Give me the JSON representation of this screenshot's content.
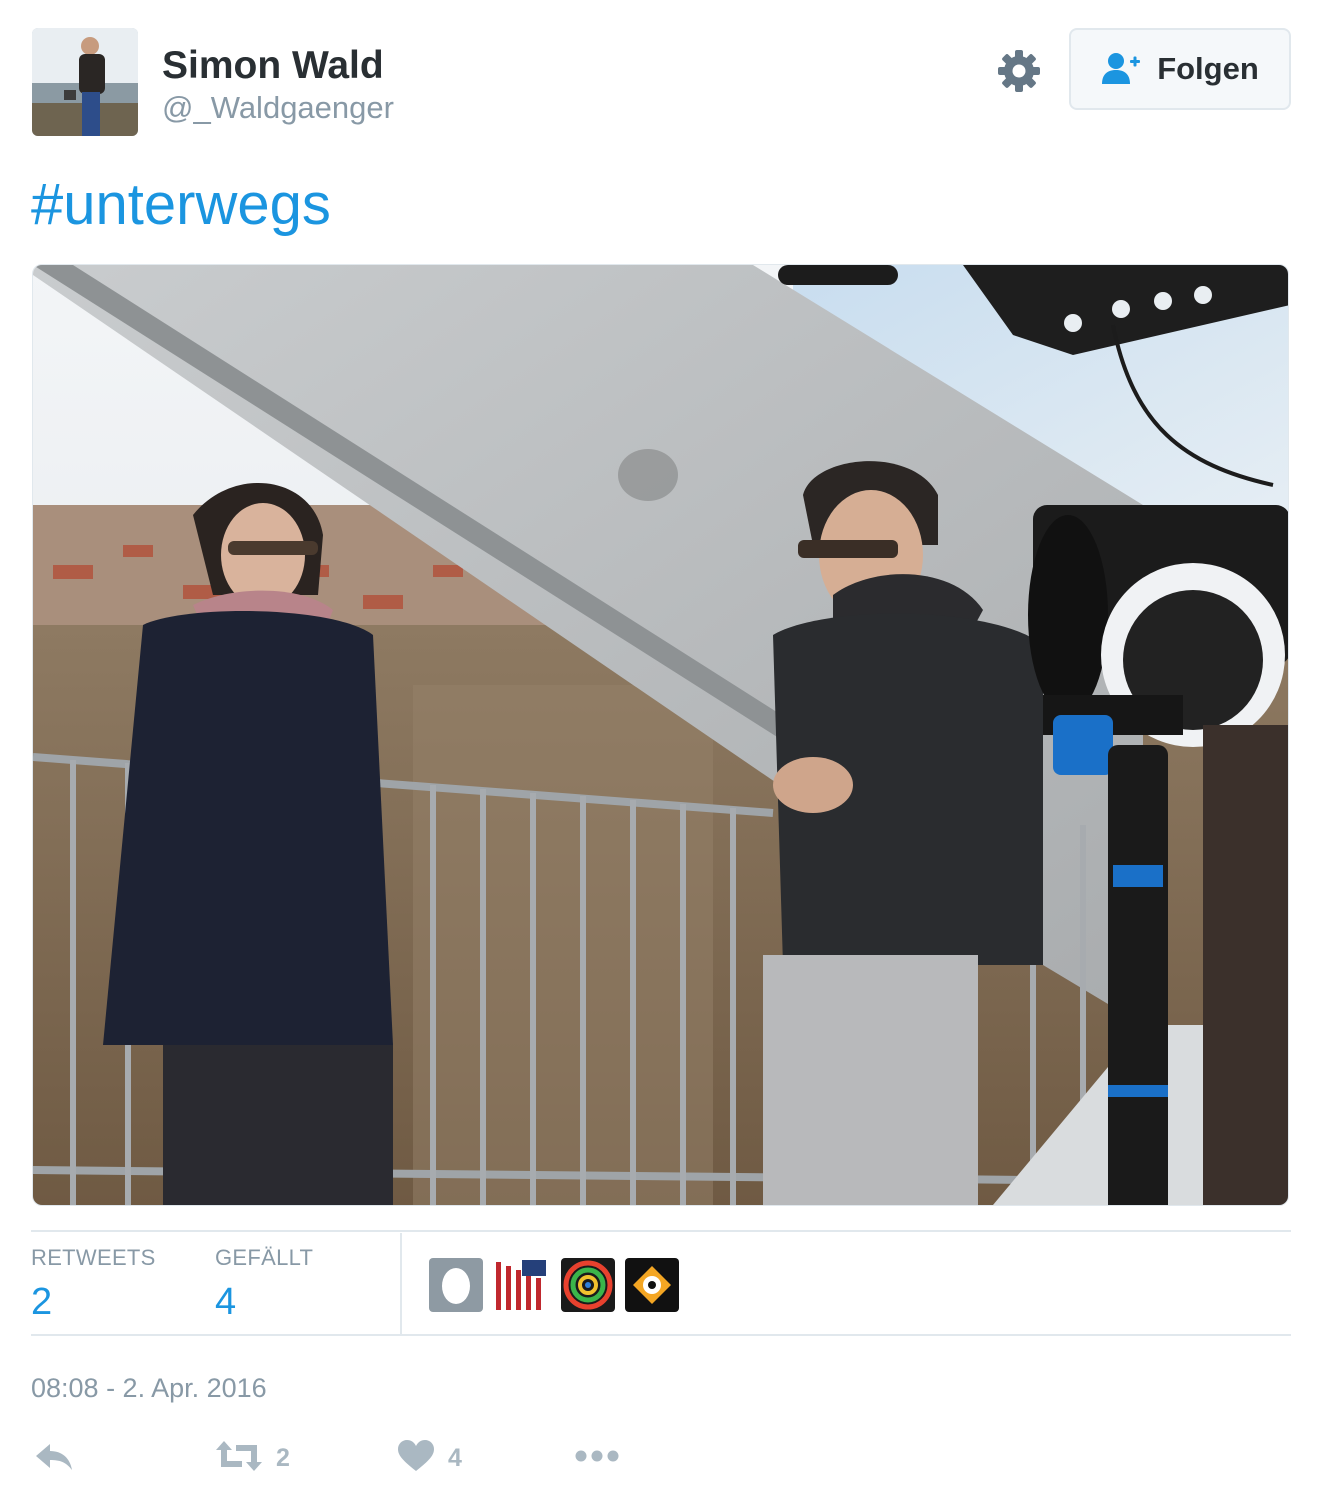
{
  "author": {
    "name": "Simon Wald",
    "handle": "@_Waldgaenger",
    "avatar_icon": "user-avatar-photo"
  },
  "header": {
    "settings_icon": "gear-icon",
    "follow_label": "Folgen",
    "follow_icon": "add-person-icon"
  },
  "tweet": {
    "text": "#unterwegs"
  },
  "stats": {
    "retweets_label": "RETWEETS",
    "retweets_count": "2",
    "likes_label": "GEFÄLLT",
    "likes_count": "4"
  },
  "timestamp": "08:08 - 2. Apr. 2016",
  "actions": {
    "reply_icon": "reply-icon",
    "retweet_icon": "retweet-icon",
    "retweet_count": "2",
    "like_icon": "heart-icon",
    "like_count": "4",
    "more_icon": "more-dots-icon"
  },
  "colors": {
    "link": "#1b95e0",
    "muted": "#8899a6",
    "text": "#292f33",
    "border": "#e1e8ed",
    "action_icon": "#aab8c2"
  }
}
